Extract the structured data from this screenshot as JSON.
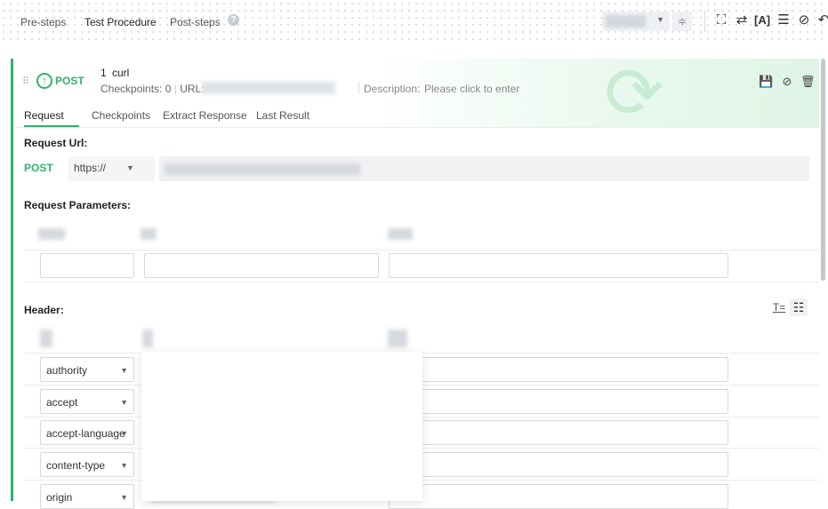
{
  "tabs": [
    {
      "label": "Pre-steps",
      "active": false
    },
    {
      "label": "Test Procedure",
      "active": true
    },
    {
      "label": "Post-steps",
      "active": false
    }
  ],
  "toolbar": {
    "icons": [
      "expand-icon",
      "swap-icon",
      "text-icon",
      "list-icon",
      "disable-icon",
      "undo-icon"
    ]
  },
  "step": {
    "method": "POST",
    "number": "1",
    "name": "curl",
    "checkpoints_label": "Checkpoints:",
    "checkpoints_count": "0",
    "url_label": "URL:",
    "description_label": "Description:",
    "description_placeholder": "Please click to enter",
    "actions": [
      "save-icon",
      "disable-icon",
      "delete-icon"
    ]
  },
  "subtabs": [
    {
      "label": "Request",
      "active": true
    },
    {
      "label": "Checkpoints",
      "active": false
    },
    {
      "label": "Extract Response",
      "active": false
    },
    {
      "label": "Last Result",
      "active": false
    }
  ],
  "request": {
    "url_title": "Request Url:",
    "method": "POST",
    "scheme": "https://",
    "params_title": "Request Parameters:",
    "header_title": "Header:"
  },
  "headers": [
    {
      "name": "authority"
    },
    {
      "name": "accept"
    },
    {
      "name": "accept-language"
    },
    {
      "name": "content-type"
    },
    {
      "name": "origin"
    }
  ],
  "colors": {
    "accent": "#32b16c",
    "border": "#d9d9d9"
  }
}
